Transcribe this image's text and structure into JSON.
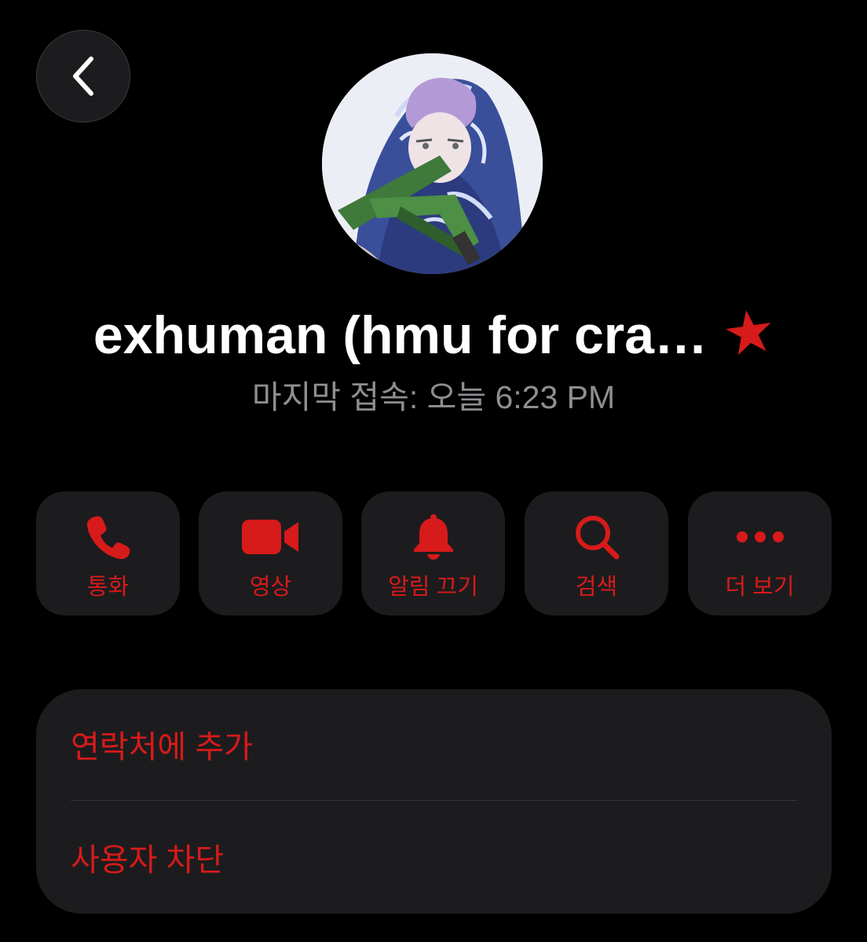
{
  "header": {
    "back_icon": "chevron-left-icon"
  },
  "profile": {
    "avatar": "profile-avatar-image",
    "name": "exhuman (hmu for cra…",
    "badge_icon": "star-icon",
    "status": "마지막 접속: 오늘 6:23 PM"
  },
  "actions": [
    {
      "label": "통화",
      "icon": "phone-icon"
    },
    {
      "label": "영상",
      "icon": "video-camera-icon"
    },
    {
      "label": "알림 끄기",
      "icon": "bell-icon"
    },
    {
      "label": "검색",
      "icon": "search-icon"
    },
    {
      "label": "더 보기",
      "icon": "more-icon"
    }
  ],
  "menu": {
    "add_contact": "연락처에 추가",
    "block_user": "사용자 차단"
  },
  "colors": {
    "background": "#000000",
    "surface": "#1c1c1e",
    "accent": "#d71a1a",
    "secondary_text": "#8e8e93",
    "primary_text": "#ffffff"
  }
}
